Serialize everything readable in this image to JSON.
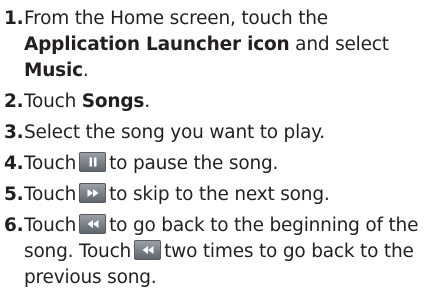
{
  "steps": [
    {
      "number": "1.",
      "a": "From the Home screen, touch the ",
      "b": "Application Launcher icon",
      "c": " and select ",
      "d": "Music",
      "e": "."
    },
    {
      "number": "2.",
      "a": "Touch ",
      "b": "Songs",
      "c": "."
    },
    {
      "number": "3.",
      "a": "Select the song you want to play."
    },
    {
      "number": "4.",
      "a": "Touch",
      "icon": "pause-icon",
      "b": "to pause the song."
    },
    {
      "number": "5.",
      "a": "Touch",
      "icon": "fast-forward-icon",
      "b": "to skip to the next song."
    },
    {
      "number": "6.",
      "a": "Touch",
      "icon": "rewind-icon",
      "b": "to go back to the beginning of the song. Touch",
      "c": "two times to go back to the previous song."
    }
  ]
}
